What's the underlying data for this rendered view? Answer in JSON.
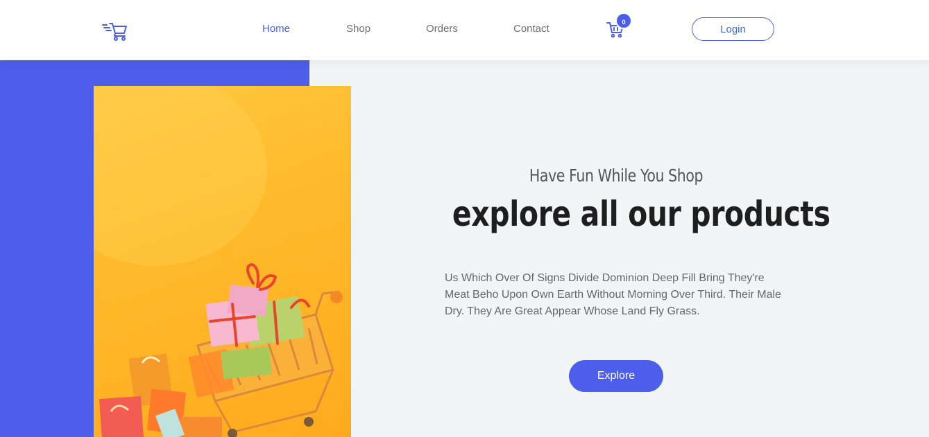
{
  "header": {
    "logo_icon": "cart-speed-icon",
    "nav": [
      {
        "label": "Home",
        "active": true
      },
      {
        "label": "Shop",
        "active": false
      },
      {
        "label": "Orders",
        "active": false
      },
      {
        "label": "Contact",
        "active": false
      }
    ],
    "cart_icon": "shopping-cart-icon",
    "cart_count": "0",
    "login_label": "Login"
  },
  "hero": {
    "image": "shopping-cart-with-gifts-photo",
    "subtitle": "Have Fun While You Shop",
    "title": "explore all our products",
    "description": "Us Which Over Of Signs Divide Dominion Deep Fill Bring They're Meat Beho Upon Own Earth Without Morning Over Third. Their Male Dry. They Are Great Appear Whose Land Fly Grass.",
    "cta_label": "Explore"
  },
  "colors": {
    "accent": "#4c5eea",
    "hero_bg": "#f1f5f5",
    "image_bg": "#ffb92a"
  }
}
